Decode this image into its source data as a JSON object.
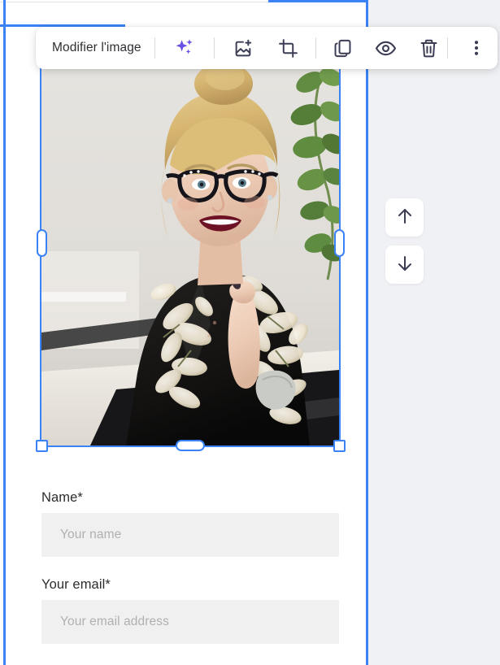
{
  "toolbar": {
    "edit_image_label": "Modifier l'image",
    "buttons": [
      {
        "name": "ai-enhance-icon",
        "label": "AI"
      },
      {
        "name": "replace-image-icon",
        "label": "Remplacer l'image"
      },
      {
        "name": "crop-icon",
        "label": "Recadrer"
      },
      {
        "name": "duplicate-icon",
        "label": "Dupliquer"
      },
      {
        "name": "visibility-icon",
        "label": "Afficher / Masquer"
      },
      {
        "name": "delete-icon",
        "label": "Supprimer"
      },
      {
        "name": "more-options-icon",
        "label": "Plus d'options"
      }
    ]
  },
  "move_controls": {
    "up_label": "Déplacer vers le haut",
    "down_label": "Déplacer vers le bas"
  },
  "form": {
    "fields": [
      {
        "label": "Name*",
        "placeholder": "Your name"
      },
      {
        "label": "Your email*",
        "placeholder": "Your email address"
      }
    ]
  },
  "colors": {
    "accent_blue": "#3b82f6",
    "ai_purple": "#6b4ee6",
    "icon_dark": "#3b3d55",
    "panel_gray": "#f0f1f4",
    "input_gray": "#f0f0f0"
  }
}
